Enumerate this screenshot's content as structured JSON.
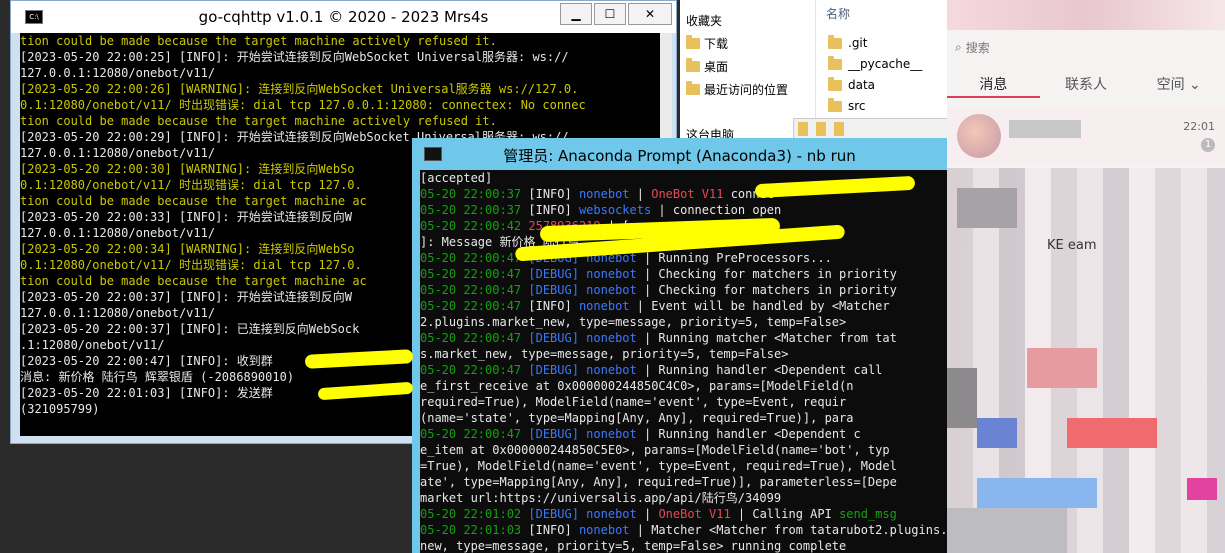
{
  "explorer": {
    "nav": [
      {
        "label": "收藏夹"
      },
      {
        "label": "下载"
      },
      {
        "label": "桌面"
      },
      {
        "label": "最近访问的位置"
      },
      {
        "label": "这台电脑"
      }
    ],
    "column_header": "名称",
    "files": [
      ".git",
      "__pycache__",
      "data",
      "src"
    ]
  },
  "chat": {
    "search_placeholder": "搜索",
    "tabs": [
      {
        "label": "消息"
      },
      {
        "label": "联系人"
      },
      {
        "label": "空间"
      }
    ],
    "conversation": {
      "time": "22:01",
      "unread": "1"
    },
    "partial_label": "KE      eam"
  },
  "cqhttp_window": {
    "title": "go-cqhttp v1.0.1 © 2020 - 2023 Mrs4s",
    "buttons": {
      "minimize": "▁",
      "maximize": "☐",
      "close": "✕"
    },
    "lines": [
      {
        "t": "tion could be made because the target machine actively refused it.",
        "c": "y"
      },
      {
        "t": "[2023-05-20 22:00:25] [INFO]: 开始尝试连接到反向WebSocket Universal服务器: ws://",
        "c": "w"
      },
      {
        "t": "127.0.0.1:12080/onebot/v11/",
        "c": "w"
      },
      {
        "t": "[2023-05-20 22:00:26] [WARNING]: 连接到反向WebSocket Universal服务器 ws://127.0.",
        "c": "y"
      },
      {
        "t": "0.1:12080/onebot/v11/ 时出现错误: dial tcp 127.0.0.1:12080: connectex: No connec",
        "c": "y"
      },
      {
        "t": "tion could be made because the target machine actively refused it.",
        "c": "y"
      },
      {
        "t": "[2023-05-20 22:00:29] [INFO]: 开始尝试连接到反向WebSocket Universal服务器: ws://",
        "c": "w"
      },
      {
        "t": "127.0.0.1:12080/onebot/v11/",
        "c": "w"
      },
      {
        "t": "[2023-05-20 22:00:30] [WARNING]: 连接到反向WebSo",
        "c": "y"
      },
      {
        "t": "0.1:12080/onebot/v11/ 时出现错误: dial tcp 127.0.",
        "c": "y"
      },
      {
        "t": "tion could be made because the target machine ac",
        "c": "y"
      },
      {
        "t": "[2023-05-20 22:00:33] [INFO]: 开始尝试连接到反向W",
        "c": "w"
      },
      {
        "t": "127.0.0.1:12080/onebot/v11/",
        "c": "w"
      },
      {
        "t": "[2023-05-20 22:00:34] [WARNING]: 连接到反向WebSo",
        "c": "y"
      },
      {
        "t": "0.1:12080/onebot/v11/ 时出现错误: dial tcp 127.0.",
        "c": "y"
      },
      {
        "t": "tion could be made because the target machine ac",
        "c": "y"
      },
      {
        "t": "[2023-05-20 22:00:37] [INFO]: 开始尝试连接到反向W",
        "c": "w"
      },
      {
        "t": "127.0.0.1:12080/onebot/v11/",
        "c": "w"
      },
      {
        "t": "[2023-05-20 22:00:37] [INFO]: 已连接到反向WebSock",
        "c": "w"
      },
      {
        "t": ".1:12080/onebot/v11/",
        "c": "w"
      },
      {
        "t": "[2023-05-20 22:00:47] [INFO]: 收到群",
        "c": "w"
      },
      {
        "t": "消息: 新价格 陆行鸟 辉翠银盾 (-2086890010)",
        "c": "w"
      },
      {
        "t": "[2023-05-20 22:01:03] [INFO]: 发送群",
        "c": "w"
      },
      {
        "t": " (321095799)",
        "c": "w"
      }
    ]
  },
  "anaconda_window": {
    "title": "管理员: Anaconda Prompt (Anaconda3) - nb  run",
    "lines": [
      [
        {
          "t": "[accepted]",
          "c": "w"
        }
      ],
      [
        {
          "t": "05-20 22:00:37 ",
          "c": "g"
        },
        {
          "t": "[INFO] ",
          "c": "w"
        },
        {
          "t": "nonebot",
          "c": "b"
        },
        {
          "t": " | ",
          "c": "w"
        },
        {
          "t": "OneBot V11",
          "c": "r"
        },
        {
          "t": "                     connec",
          "c": "w"
        }
      ],
      [
        {
          "t": "05-20 22:00:37 ",
          "c": "g"
        },
        {
          "t": "[INFO] ",
          "c": "w"
        },
        {
          "t": "websockets",
          "c": "b"
        },
        {
          "t": " | connection open",
          "c": "w"
        }
      ],
      [
        {
          "t": "05-20 22:00:42 ",
          "c": "g"
        },
        {
          "t": "                    ",
          "c": "w"
        },
        {
          "t": "2578936219",
          "c": "r"
        },
        {
          "t": " | [messag",
          "c": "w"
        }
      ],
      [
        {
          "t": "]: Message ",
          "c": "w"
        },
        {
          "t": "                                 新价格 陆行鸟",
          "c": "w"
        }
      ],
      [
        {
          "t": "05-20 22:00:47 ",
          "c": "g"
        },
        {
          "t": "[DEBUG] ",
          "c": "b"
        },
        {
          "t": "nonebot",
          "c": "b"
        },
        {
          "t": " | Running PreProcessors...",
          "c": "w"
        }
      ],
      [
        {
          "t": "05-20 22:00:47 ",
          "c": "g"
        },
        {
          "t": "[DEBUG] ",
          "c": "b"
        },
        {
          "t": "nonebot",
          "c": "b"
        },
        {
          "t": " | Checking for matchers in priority",
          "c": "w"
        }
      ],
      [
        {
          "t": "05-20 22:00:47 ",
          "c": "g"
        },
        {
          "t": "[DEBUG] ",
          "c": "b"
        },
        {
          "t": "nonebot",
          "c": "b"
        },
        {
          "t": " | Checking for matchers in priority",
          "c": "w"
        }
      ],
      [
        {
          "t": "05-20 22:00:47 ",
          "c": "g"
        },
        {
          "t": "[INFO] ",
          "c": "w"
        },
        {
          "t": "nonebot",
          "c": "b"
        },
        {
          "t": " | Event will be handled by <Matcher",
          "c": "w"
        }
      ],
      [
        {
          "t": "2.plugins.market_new, type=message, priority=5, temp=False>",
          "c": "w"
        }
      ],
      [
        {
          "t": "05-20 22:00:47 ",
          "c": "g"
        },
        {
          "t": "[DEBUG] ",
          "c": "b"
        },
        {
          "t": "nonebot",
          "c": "b"
        },
        {
          "t": " | Running matcher <Matcher from tat",
          "c": "w"
        }
      ],
      [
        {
          "t": "s.market_new, type=message, priority=5, temp=False>",
          "c": "w"
        }
      ],
      [
        {
          "t": "05-20 22:00:47 ",
          "c": "g"
        },
        {
          "t": "[DEBUG] ",
          "c": "b"
        },
        {
          "t": "nonebot",
          "c": "b"
        },
        {
          "t": " | Running handler <Dependent call",
          "c": "w"
        }
      ],
      [
        {
          "t": "e_first_receive at 0x000000244850C4C0>, params=[ModelField(n",
          "c": "w"
        }
      ],
      [
        {
          "t": " required=True), ModelField(name='event', type=Event, requir",
          "c": "w"
        }
      ],
      [
        {
          "t": "(name='state', type=Mapping[Any, Any], required=True)], para",
          "c": "w"
        }
      ],
      [
        {
          "t": "05-20 22:00:47 ",
          "c": "g"
        },
        {
          "t": "[DEBUG] ",
          "c": "b"
        },
        {
          "t": "nonebot",
          "c": "b"
        },
        {
          "t": " | Running handler <Dependent c",
          "c": "w"
        }
      ],
      [
        {
          "t": "e_item at 0x000000244850C5E0>, params=[ModelField(name='bot', typ",
          "c": "w"
        }
      ],
      [
        {
          "t": "=True), ModelField(name='event', type=Event, required=True), Model",
          "c": "w"
        }
      ],
      [
        {
          "t": "ate', type=Mapping[Any, Any], required=True)], parameterless=[Depe",
          "c": "w"
        }
      ],
      [
        {
          "t": "market url:https://universalis.app/api/陆行鸟/34099",
          "c": "w"
        }
      ],
      [
        {
          "t": "05-20 22:01:02 ",
          "c": "g"
        },
        {
          "t": "[DEBUG] ",
          "c": "b"
        },
        {
          "t": "nonebot",
          "c": "b"
        },
        {
          "t": " | ",
          "c": "w"
        },
        {
          "t": "OneBot V11",
          "c": "r"
        },
        {
          "t": " | Calling API ",
          "c": "w"
        },
        {
          "t": "send_msg",
          "c": "g"
        }
      ],
      [
        {
          "t": "05-20 22:01:03 ",
          "c": "g"
        },
        {
          "t": "[INFO] ",
          "c": "w"
        },
        {
          "t": "nonebot",
          "c": "b"
        },
        {
          "t": " | Matcher <Matcher from tatarubot2.plugins.market_",
          "c": "w"
        }
      ],
      [
        {
          "t": "new, type=message, priority=5, temp=False> running complete",
          "c": "w"
        }
      ]
    ]
  }
}
